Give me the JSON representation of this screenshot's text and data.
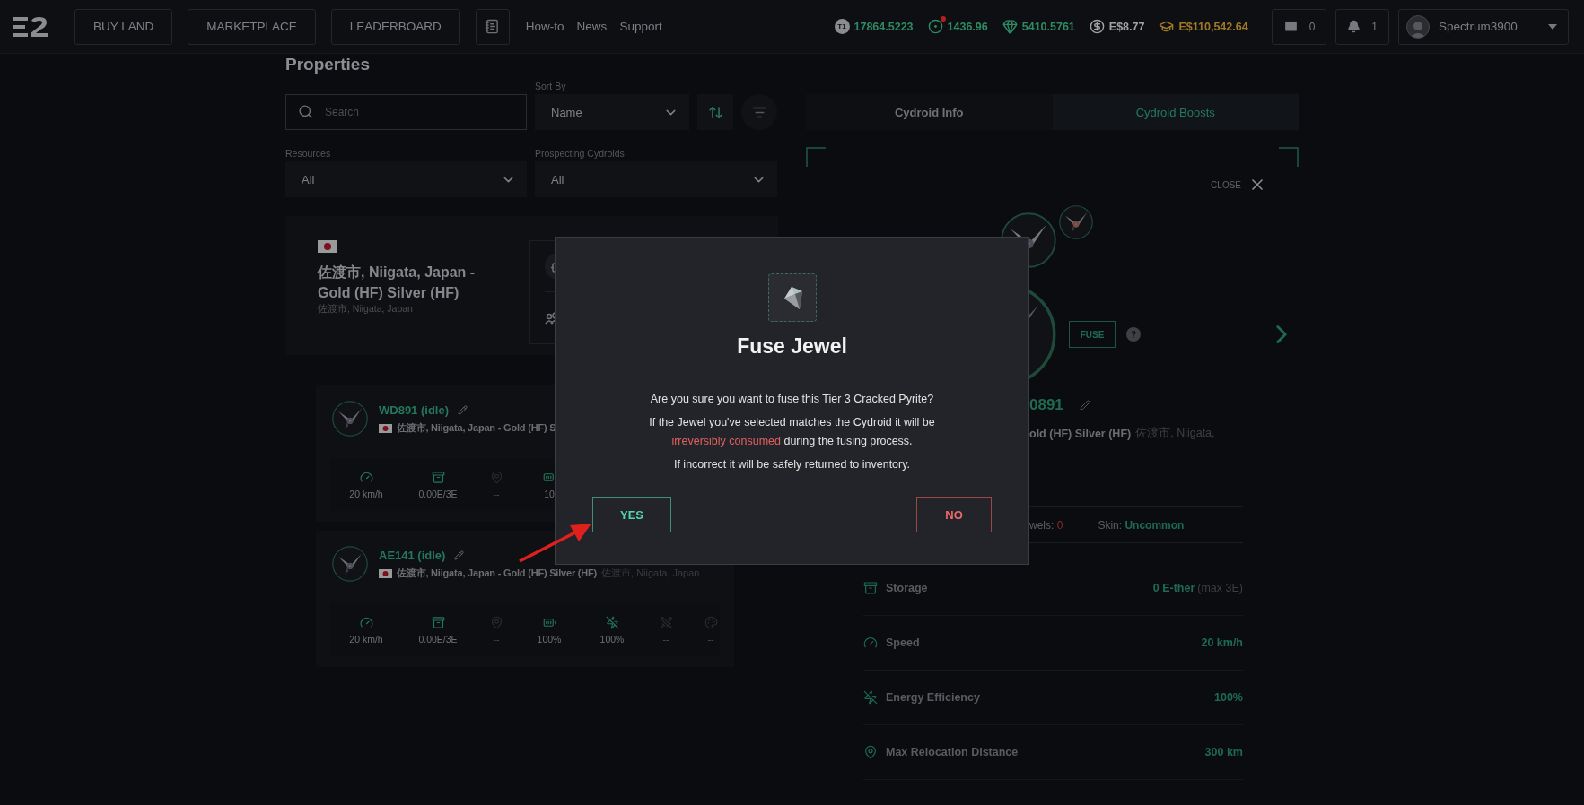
{
  "topbar": {
    "nav_buttons": [
      "BUY LAND",
      "MARKETPLACE",
      "LEADERBOARD"
    ],
    "links": [
      "How-to",
      "News",
      "Support"
    ],
    "balances": [
      {
        "kind": "tier",
        "icon_label": "T1",
        "value": "17864.5223",
        "color": "#2e8a64",
        "alert": false
      },
      {
        "kind": "ring",
        "value": "1436.96",
        "color": "#2e8a64",
        "alert": true
      },
      {
        "kind": "diamond",
        "value": "5410.5761",
        "color": "#2e8a64",
        "alert": false
      },
      {
        "kind": "dollar",
        "value": "E$8.77",
        "color": "#a0a2a6",
        "alert": false
      },
      {
        "kind": "cap",
        "value": "E$110,542.64",
        "color": "#a07a26",
        "alert": false
      }
    ],
    "mail_count": "0",
    "notification_count": "1",
    "user": "Spectrum3900"
  },
  "properties": {
    "title": "Properties",
    "search": {
      "placeholder": "Search"
    },
    "sort_by": {
      "label": "Sort By",
      "value": "Name"
    },
    "resources": {
      "label": "Resources",
      "value": "All"
    },
    "prospecting": {
      "label": "Prospecting Cydroids",
      "value": "All"
    },
    "property": {
      "title": "佐渡市, Niigata, Japan - Gold (HF) Silver (HF)",
      "subtitle": "佐渡市, Niigata, Japan"
    },
    "cydroids": [
      {
        "name": "WD891 (idle)",
        "location": "佐渡市, Niigata, Japan - Gold (HF) S",
        "stats": [
          {
            "kind": "speed",
            "value": "20 km/h",
            "active": true
          },
          {
            "kind": "storage",
            "value": "0.00E/3E",
            "active": true
          },
          {
            "kind": "distance",
            "value": "--",
            "active": false
          },
          {
            "kind": "battery",
            "value": "10",
            "active": true
          }
        ]
      },
      {
        "name": "AE141 (idle)",
        "location": "佐渡市, Niigata, Japan - Gold (HF) Silver (HF)",
        "sublocation": "佐渡市, Niigata, Japan",
        "stats": [
          {
            "kind": "speed",
            "value": "20 km/h",
            "active": true
          },
          {
            "kind": "storage",
            "value": "0.00E/3E",
            "active": true
          },
          {
            "kind": "distance",
            "value": "--",
            "active": false
          },
          {
            "kind": "battery",
            "value": "100%",
            "active": true
          },
          {
            "kind": "energy",
            "value": "100%",
            "active": true
          },
          {
            "kind": "raid",
            "value": "--",
            "active": false
          },
          {
            "kind": "skin",
            "value": "--",
            "active": false
          }
        ]
      }
    ]
  },
  "cydroid_panel": {
    "tabs": [
      {
        "label": "Cydroid Info",
        "selected": false
      },
      {
        "label": "Cydroid Boosts",
        "selected": true
      }
    ],
    "close_label": "CLOSE",
    "fuse_label": "FUSE",
    "help_label": "?",
    "name": "0891",
    "location": "old (HF) Silver (HF)",
    "location_sub": "佐渡市, Niigata,",
    "jewels": {
      "label": "wels:",
      "value": "0"
    },
    "skin": {
      "label": "Skin:",
      "value": "Uncommon"
    },
    "stats": [
      {
        "kind": "storage",
        "label": "Storage",
        "value": "0 E-ther",
        "note": "(max 3E)"
      },
      {
        "kind": "speed",
        "label": "Speed",
        "value": "20 km/h"
      },
      {
        "kind": "energy",
        "label": "Energy Efficiency",
        "value": "100%"
      },
      {
        "kind": "distance",
        "label": "Max Relocation Distance",
        "value": "300 km"
      }
    ]
  },
  "dialog": {
    "title": "Fuse Jewel",
    "question": "Are you sure you want to fuse this Tier 3 Cracked Pyrite?",
    "warning": [
      {
        "text": "If the Jewel you've selected matches the Cydroid it will be ",
        "highlight": false
      },
      {
        "text": "irreversibly consumed",
        "highlight": true
      },
      {
        "text": " during the fusing process.",
        "highlight": false
      }
    ],
    "note": "If incorrect it will be safely returned to inventory.",
    "buttons": [
      {
        "label": "YES",
        "kind": "confirm"
      },
      {
        "label": "NO",
        "kind": "cancel"
      }
    ]
  }
}
